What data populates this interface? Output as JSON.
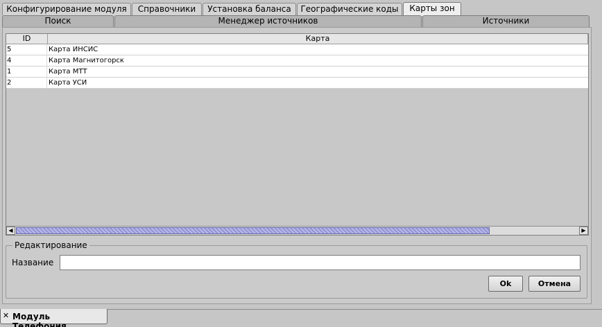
{
  "top_tabs": [
    {
      "label": "Конфигурирование модуля",
      "active": false
    },
    {
      "label": "Справочники",
      "active": false
    },
    {
      "label": "Установка баланса",
      "active": false
    },
    {
      "label": "Географические коды",
      "active": false
    },
    {
      "label": "Карты зон",
      "active": true
    }
  ],
  "sub_tabs": [
    {
      "label": "Поиск"
    },
    {
      "label": "Менеджер источников"
    },
    {
      "label": "Источники"
    }
  ],
  "table": {
    "columns": [
      "ID",
      "Карта"
    ],
    "rows": [
      {
        "id": "5",
        "name": "Карта ИНСИС"
      },
      {
        "id": "4",
        "name": "Карта Магнитогорск"
      },
      {
        "id": "1",
        "name": "Карта МТТ"
      },
      {
        "id": "2",
        "name": "Карта УСИ"
      }
    ],
    "scroll_left_icon": "arrow-left-icon",
    "scroll_right_icon": "arrow-right-icon"
  },
  "edit": {
    "legend": "Редактирование",
    "name_label": "Название",
    "name_value": "",
    "ok_label": "Ok",
    "cancel_label": "Отмена"
  },
  "bottom_tab": {
    "label": "Модуль Телефония",
    "close_icon": "close-icon"
  },
  "colors": {
    "scroll_thumb": "#9494d4",
    "background": "#c6c6c6"
  }
}
